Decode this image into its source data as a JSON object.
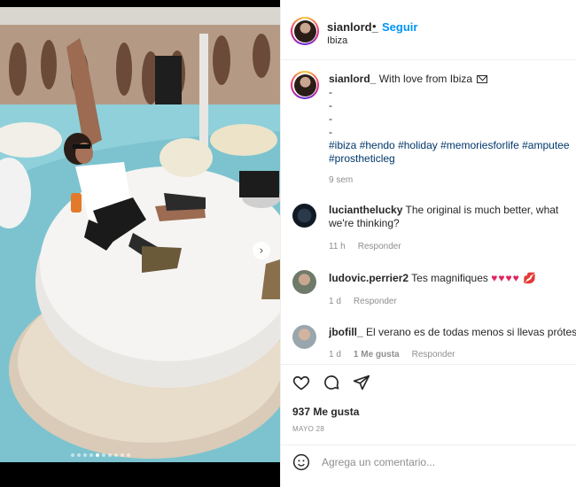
{
  "post": {
    "author": "sianlord_",
    "separator": "•",
    "follow_label": "Seguir",
    "location": "Ibiza",
    "caption_user": "sianlord_",
    "caption_text": "With love from Ibiza",
    "caption_dashes": [
      "-",
      "-",
      "-",
      "-"
    ],
    "hashtags": "#ibiza #hendo #holiday #memoriesforlife #amputee #prostheticleg",
    "caption_time": "9 sem",
    "likes": "937 Me gusta",
    "date": "MAYO 28",
    "comment_placeholder": "Agrega un comentario...",
    "carousel": {
      "total": 10,
      "active": 5
    }
  },
  "comments": [
    {
      "user": "lucianthelucky",
      "text": "The original is much better, what we're thinking?",
      "time": "11 h",
      "reply": "Responder",
      "likes": ""
    },
    {
      "user": "ludovic.perrier2",
      "text": "Tes magnifiques",
      "emoji_hearts": "♥♥♥♥",
      "emoji_kiss": "💋",
      "time": "1 d",
      "reply": "Responder",
      "likes": ""
    },
    {
      "user": "jbofill_",
      "text": "El verano es de todas menos si llevas prótesis",
      "time": "1 d",
      "likes": "1 Me gusta",
      "reply": "Responder"
    }
  ],
  "icons": {
    "like": "heart-icon",
    "comment": "comment-bubble-icon",
    "share": "paper-plane-icon",
    "emoji": "smiley-icon",
    "next": "chevron-right-icon"
  },
  "colors": {
    "link_blue": "#0095f6",
    "hashtag": "#00376b",
    "muted": "#8e8e8e",
    "text": "#262626"
  }
}
